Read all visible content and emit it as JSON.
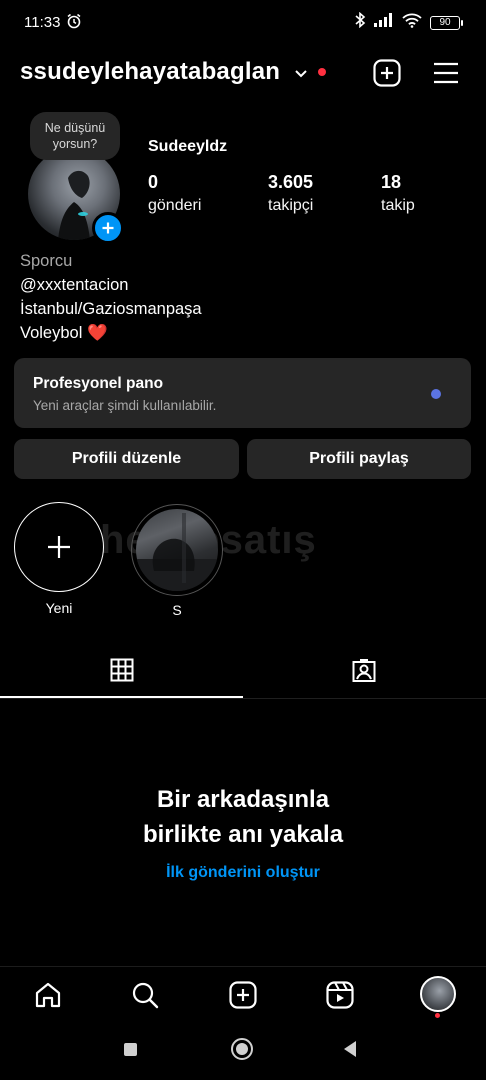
{
  "status_bar": {
    "time": "11:33",
    "battery": "90",
    "icons": [
      "alarm-icon",
      "bluetooth-icon",
      "signal-icon",
      "wifi-icon",
      "battery-icon"
    ]
  },
  "header": {
    "username": "ssudeylehayatabaglan",
    "icons": [
      "chevron-down-icon",
      "create-icon",
      "menu-icon"
    ]
  },
  "profile": {
    "note": "Ne düşünü yorsun?",
    "display_name": "Sudeeyldz",
    "stats": [
      {
        "value": "0",
        "label": "gönderi"
      },
      {
        "value": "3.605",
        "label": "takipçi"
      },
      {
        "value": "18",
        "label": "takip"
      }
    ],
    "category": "Sporcu",
    "bio": [
      "@xxxtentacion",
      "İstanbul/Gaziosmanpaşa",
      "Voleybol ❤️"
    ]
  },
  "pro_dashboard": {
    "title": "Profesyonel pano",
    "subtitle": "Yeni araçlar şimdi kullanılabilir."
  },
  "buttons": {
    "edit_profile": "Profili düzenle",
    "share_profile": "Profili paylaş"
  },
  "highlights": [
    {
      "label": "Yeni"
    },
    {
      "label": "S"
    }
  ],
  "watermark": "hesapsatış",
  "tabs": [
    "grid-icon",
    "tagged-icon"
  ],
  "empty_state": {
    "title_line1": "Bir arkadaşınla",
    "title_line2": "birlikte anı yakala",
    "link": "İlk gönderini oluştur"
  },
  "bottom_nav": [
    "home-icon",
    "search-icon",
    "create-icon",
    "reels-icon",
    "profile-avatar"
  ],
  "colors": {
    "background": "#000000",
    "card": "#262626",
    "accent": "#0095f6",
    "notification": "#ff3040",
    "pro_dot": "#5b74e3"
  }
}
